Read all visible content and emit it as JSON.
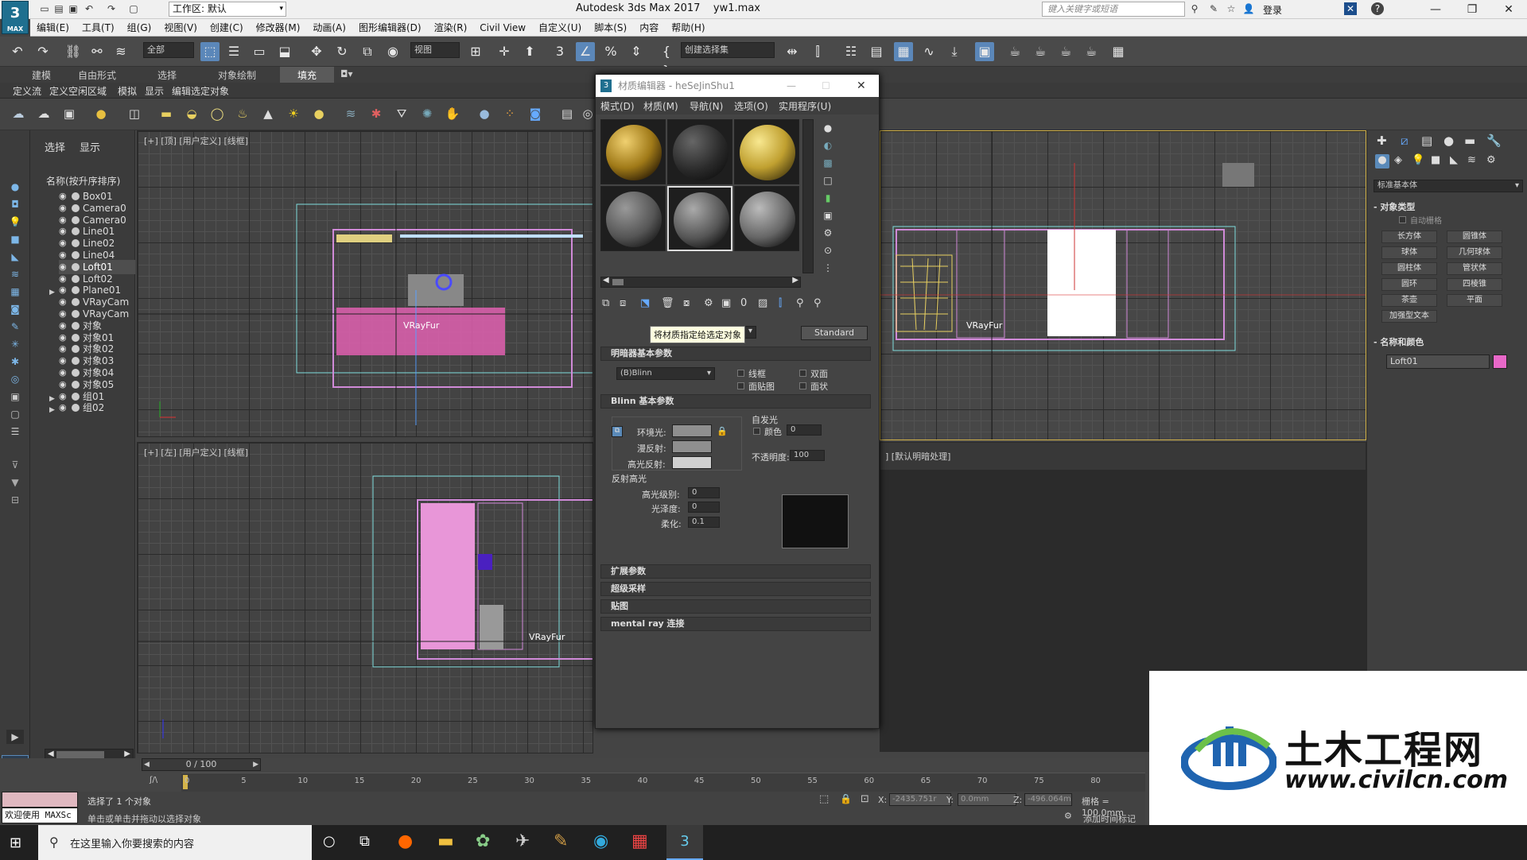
{
  "app": {
    "title": "Autodesk 3ds Max 2017",
    "file": "yw1.max",
    "logo_label": "MAX",
    "workspace": "工作区: 默认",
    "search_placeholder": "键入关键字或短语",
    "login": "登录"
  },
  "menubar": [
    "编辑(E)",
    "工具(T)",
    "组(G)",
    "视图(V)",
    "创建(C)",
    "修改器(M)",
    "动画(A)",
    "图形编辑器(D)",
    "渲染(R)",
    "Civil View",
    "自定义(U)",
    "脚本(S)",
    "内容",
    "帮助(H)"
  ],
  "toolbar": {
    "selection_filter": "全部",
    "ref_coord": "视图",
    "named_selection": "创建选择集"
  },
  "ribbon": {
    "tabs": [
      "建模",
      "自由形式",
      "选择",
      "对象绘制",
      "填充"
    ],
    "active_tab": "填充",
    "subtabs": [
      "定义流",
      "定义空闲区域",
      "模拟",
      "显示",
      "编辑选定对象"
    ]
  },
  "scene_explorer": {
    "tabs": [
      "选择",
      "显示"
    ],
    "header": "名称(按升序排序)",
    "objects": [
      {
        "name": "Box01",
        "selected": false
      },
      {
        "name": "Camera0",
        "selected": false
      },
      {
        "name": "Camera0",
        "selected": false
      },
      {
        "name": "Line01",
        "selected": false
      },
      {
        "name": "Line02",
        "selected": false
      },
      {
        "name": "Line04",
        "selected": false
      },
      {
        "name": "Loft01",
        "selected": true
      },
      {
        "name": "Loft02",
        "selected": false
      },
      {
        "name": "Plane01",
        "selected": false
      },
      {
        "name": "VRayCam",
        "selected": false
      },
      {
        "name": "VRayCam",
        "selected": false
      },
      {
        "name": "对象",
        "selected": false
      },
      {
        "name": "对象01",
        "selected": false
      },
      {
        "name": "对象02",
        "selected": false
      },
      {
        "name": "对象03",
        "selected": false
      },
      {
        "name": "对象04",
        "selected": false
      },
      {
        "name": "对象05",
        "selected": false
      },
      {
        "name": "组01",
        "selected": false
      },
      {
        "name": "组02",
        "selected": false
      }
    ]
  },
  "viewports": {
    "top_label": "[+] [顶] [用户定义] [线框]",
    "left_label": "[+] [左] [用户定义] [线框]",
    "persp_label": "] [默认明暗处理]",
    "fur_label": "VRayFur"
  },
  "material_editor": {
    "title": "材质编辑器 - heSeJinShu1",
    "menu": [
      "模式(D)",
      "材质(M)",
      "导航(N)",
      "选项(O)",
      "实用程序(U)"
    ],
    "tooltip": "将材质指定给选定对象",
    "type_button": "Standard",
    "shader_rollout": "明暗器基本参数",
    "shader": "(B)Blinn",
    "shader_checks": [
      "线框",
      "双面",
      "面贴图",
      "面状"
    ],
    "blinn_rollout": "Blinn 基本参数",
    "ambient": "环境光:",
    "diffuse": "漫反射:",
    "specular": "高光反射:",
    "self_illum": "自发光",
    "color_label": "颜色",
    "color_value": "0",
    "opacity_label": "不透明度:",
    "opacity_value": "100",
    "spec_highlights": "反射高光",
    "spec_level_label": "高光级别:",
    "spec_level": "0",
    "gloss_label": "光泽度:",
    "gloss": "0",
    "soften_label": "柔化:",
    "soften": "0.1",
    "rollouts": [
      "扩展参数",
      "超级采样",
      "贴图",
      "mental ray 连接"
    ],
    "swatch_colors": {
      "ambient": "#8f8f8f",
      "diffuse": "#8f8f8f",
      "specular": "#d0d0d0"
    }
  },
  "command_panel": {
    "category": "标准基本体",
    "object_type": "对象类型",
    "autogrid": "自动栅格",
    "buttons": [
      "长方体",
      "圆锥体",
      "球体",
      "几何球体",
      "圆柱体",
      "管状体",
      "圆环",
      "四棱锥",
      "茶壶",
      "平面",
      "加强型文本"
    ],
    "name_color": "名称和颜色",
    "object_name": "Loft01",
    "object_color": "#e868c8"
  },
  "timeline": {
    "frame": "0 / 100",
    "ticks": [
      "0",
      "5",
      "10",
      "15",
      "20",
      "25",
      "30",
      "35",
      "40",
      "45",
      "50",
      "55",
      "60",
      "65",
      "70",
      "75",
      "80"
    ]
  },
  "status": {
    "maxscript": "欢迎使用 MAXSc",
    "selected": "选择了 1 个对象",
    "prompt": "单击或单击并拖动以选择对象",
    "x_label": "X:",
    "x": "-2435.751r",
    "y_label": "Y:",
    "y": "0.0mm",
    "z_label": "Z:",
    "z": "-496.064m",
    "grid": "栅格 = 100.0mm",
    "add_tag": "添加时间标记"
  },
  "taskbar": {
    "search": "在这里输入你要搜索的内容"
  },
  "watermark": {
    "brand": "土木工程网",
    "url": "www.civilcn.com"
  }
}
